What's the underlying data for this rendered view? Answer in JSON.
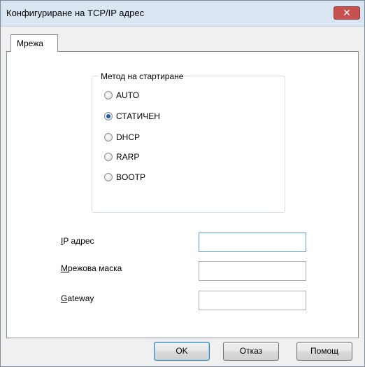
{
  "window": {
    "title": "Конфигуриране на TCP/IP адрес",
    "close_glyph": "✕"
  },
  "tabs": [
    {
      "label": "Мрежа",
      "selected": true
    }
  ],
  "boot_method": {
    "group_label": "Метод на стартиране",
    "options": [
      {
        "label": "AUTO",
        "checked": false
      },
      {
        "label": "СТАТИЧЕН",
        "checked": true
      },
      {
        "label": "DHCP",
        "checked": false
      },
      {
        "label": "RARP",
        "checked": false
      },
      {
        "label": "BOOTP",
        "checked": false
      }
    ]
  },
  "fields": {
    "ip_address": {
      "label_first": "I",
      "label_rest": "P адрес",
      "value": ""
    },
    "subnet_mask": {
      "label_first": "М",
      "label_rest": "режова маска",
      "value": ""
    },
    "gateway": {
      "label_first": "G",
      "label_rest": "ateway",
      "value": ""
    }
  },
  "buttons": {
    "ok": "OK",
    "cancel": "Отказ",
    "help": "Помощ"
  }
}
